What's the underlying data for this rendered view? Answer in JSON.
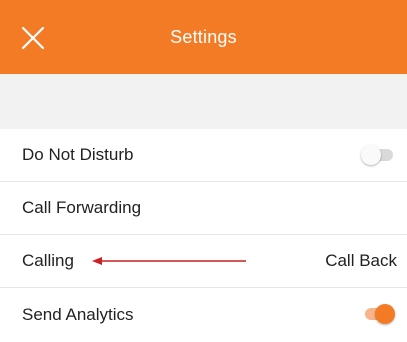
{
  "header": {
    "title": "Settings",
    "close_icon": "close-icon",
    "background_color": "#f47b25"
  },
  "spacer": {
    "color": "#f2f2f2"
  },
  "settings": [
    {
      "label": "Do Not Disturb",
      "control": "toggle",
      "enabled": false
    },
    {
      "label": "Call Forwarding",
      "control": "none"
    },
    {
      "label": "Calling",
      "control": "value",
      "value": "Call Back"
    },
    {
      "label": "Send Analytics",
      "control": "toggle",
      "enabled": true
    }
  ],
  "colors": {
    "accent": "#f47b25",
    "toggle_off_track": "#d9d9d9",
    "toggle_on_track": "#f8b48a",
    "annotation_arrow": "#cc2020"
  }
}
